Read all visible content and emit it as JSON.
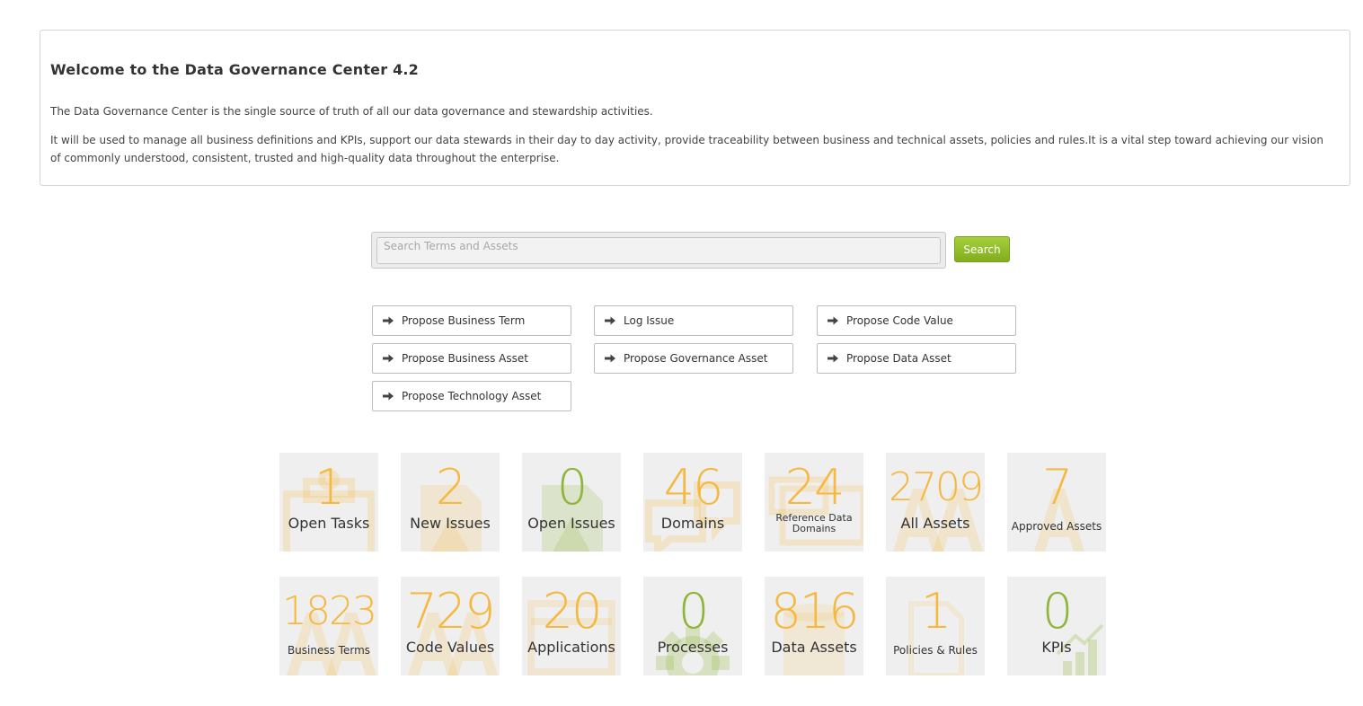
{
  "welcome": {
    "title": "Welcome to the Data Governance Center 4.2",
    "paragraph1": "The Data Governance Center is the single source of truth of all our data governance and stewardship activities.",
    "paragraph2": "It will be used to manage all business definitions and KPIs, support our data stewards in their day to day activity, provide traceability between business and technical assets, policies and rules.It is a vital step toward achieving our vision of commonly understood, consistent, trusted and high-quality data throughout the enterprise."
  },
  "search": {
    "placeholder": "Search Terms and Assets",
    "button_label": "Search"
  },
  "actions": [
    {
      "label": "Propose Business Term",
      "icon": "arrow-right-icon"
    },
    {
      "label": "Log Issue",
      "icon": "arrow-right-icon"
    },
    {
      "label": "Propose Code Value",
      "icon": "arrow-right-icon"
    },
    {
      "label": "Propose Business Asset",
      "icon": "arrow-right-icon"
    },
    {
      "label": "Propose Governance Asset",
      "icon": "arrow-right-icon"
    },
    {
      "label": "Propose Data Asset",
      "icon": "arrow-right-icon"
    },
    {
      "label": "Propose Technology Asset",
      "icon": "arrow-right-icon"
    }
  ],
  "tiles": [
    {
      "value": "1",
      "label": "Open Tasks",
      "color": "#f5b942",
      "icon": "clipboard-icon"
    },
    {
      "value": "2",
      "label": "New Issues",
      "color": "#f5b942",
      "icon": "warning-document-icon"
    },
    {
      "value": "0",
      "label": "Open Issues",
      "color": "#8fb63a",
      "icon": "warning-document-icon"
    },
    {
      "value": "46",
      "label": "Domains",
      "color": "#f5b942",
      "icon": "chat-bubbles-icon"
    },
    {
      "value": "24",
      "label": "Reference Data Domains",
      "color": "#f5b942",
      "icon": "reference-data-icon"
    },
    {
      "value": "2709",
      "label": "All Assets",
      "color": "#f5b942",
      "icon": "letters-icon"
    },
    {
      "value": "7",
      "label": "Approved Assets",
      "color": "#f5b942",
      "icon": "letters-icon"
    },
    {
      "value": "1823",
      "label": "Business Terms",
      "color": "#f5b942",
      "icon": "letters-icon"
    },
    {
      "value": "729",
      "label": "Code Values",
      "color": "#f5b942",
      "icon": "letters-icon"
    },
    {
      "value": "20",
      "label": "Applications",
      "color": "#f5b942",
      "icon": "window-icon"
    },
    {
      "value": "0",
      "label": "Processes",
      "color": "#8fb63a",
      "icon": "gear-icon"
    },
    {
      "value": "816",
      "label": "Data Assets",
      "color": "#f5b942",
      "icon": "database-icon"
    },
    {
      "value": "1",
      "label": "Policies & Rules",
      "color": "#f5b942",
      "icon": "document-icon"
    },
    {
      "value": "0",
      "label": "KPIs",
      "color": "#8fb63a",
      "icon": "bar-chart-icon"
    }
  ]
}
